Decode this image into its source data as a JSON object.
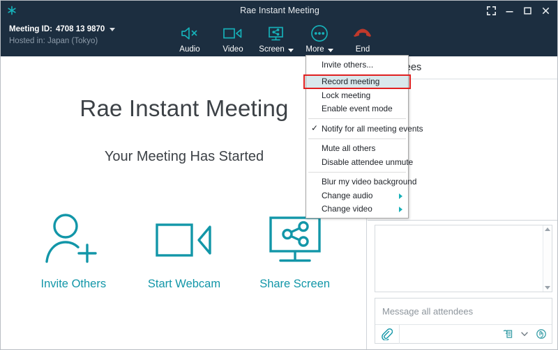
{
  "window": {
    "title": "Rae Instant Meeting",
    "logo_icon": "asterisk-logo-icon",
    "controls": [
      {
        "name": "fullscreen-button",
        "icon": "fullscreen-icon",
        "label": "Fullscreen"
      },
      {
        "name": "minimize-button",
        "icon": "minimize-icon",
        "label": "Minimize"
      },
      {
        "name": "maximize-button",
        "icon": "maximize-icon",
        "label": "Maximize"
      },
      {
        "name": "close-button",
        "icon": "close-icon",
        "label": "Close"
      }
    ]
  },
  "toolbar": {
    "meeting_id_label": "Meeting ID:",
    "meeting_id_value": "4708 13 9870",
    "hosted_in": "Hosted in: Japan (Tokyo)",
    "buttons": [
      {
        "label": "Audio",
        "icon": "speaker-muted-icon",
        "has_caret": false
      },
      {
        "label": "Video",
        "icon": "video-camera-icon",
        "has_caret": false
      },
      {
        "label": "Screen",
        "icon": "screen-share-icon",
        "has_caret": true
      },
      {
        "label": "More",
        "icon": "more-dots-icon",
        "has_caret": true
      },
      {
        "label": "End",
        "icon": "end-call-icon",
        "has_caret": false
      }
    ]
  },
  "more_menu": {
    "items": [
      {
        "label": "Invite others...",
        "checked": false,
        "submenu": false,
        "highlighted": false
      },
      {
        "label": "Record meeting",
        "checked": false,
        "submenu": false,
        "highlighted": true
      },
      {
        "label": "Lock meeting",
        "checked": false,
        "submenu": false,
        "highlighted": false
      },
      {
        "label": "Enable event mode",
        "checked": false,
        "submenu": false,
        "highlighted": false
      },
      {
        "label": "Notify for all meeting events",
        "checked": true,
        "submenu": false,
        "highlighted": false
      },
      {
        "label": "Mute all others",
        "checked": false,
        "submenu": false,
        "highlighted": false
      },
      {
        "label": "Disable attendee unmute",
        "checked": false,
        "submenu": false,
        "highlighted": false
      },
      {
        "label": "Blur my video background",
        "checked": false,
        "submenu": false,
        "highlighted": false
      },
      {
        "label": "Change audio",
        "checked": false,
        "submenu": true,
        "highlighted": false
      },
      {
        "label": "Change video",
        "checked": false,
        "submenu": true,
        "highlighted": false
      }
    ],
    "check_glyph": "✓",
    "annotation_color": "#e02020"
  },
  "stage": {
    "title": "Rae Instant Meeting",
    "subtitle": "Your Meeting Has Started",
    "actions": [
      {
        "label": "Invite Others",
        "icon": "add-person-icon"
      },
      {
        "label": "Start Webcam",
        "icon": "video-camera-icon"
      },
      {
        "label": "Share Screen",
        "icon": "screen-share-icon"
      }
    ]
  },
  "right_panel": {
    "attendees_header": "Attendees",
    "chat": {
      "placeholder": "Message all attendees",
      "value": "",
      "tools": [
        {
          "name": "attach-file-icon",
          "label": "Attach file"
        },
        {
          "name": "emoji-sticker-icon",
          "label": "Stickers"
        },
        {
          "name": "chevron-down-icon",
          "label": "More chat options"
        },
        {
          "name": "raise-hand-icon",
          "label": "Raise hand"
        }
      ],
      "scrollbar": {
        "up": "scroll-up-arrow-icon",
        "down": "scroll-down-arrow-icon"
      }
    }
  },
  "colors": {
    "titlebar_bg": "#1c2e40",
    "accent_teal": "#16b0b8",
    "link_teal": "#1296a8",
    "end_red": "#c0392b",
    "menu_highlight": "#d9e8ec",
    "annotation_red": "#e02020"
  }
}
